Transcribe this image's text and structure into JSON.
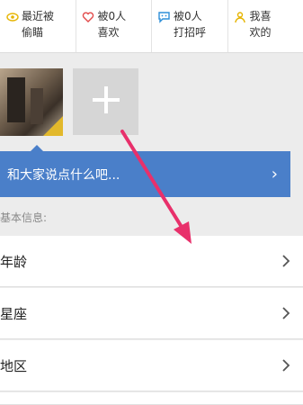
{
  "tabs": [
    {
      "icon": "eye-icon",
      "label": "最近被\n偷瞄"
    },
    {
      "icon": "heart-icon",
      "label": "被0人\n喜欢"
    },
    {
      "icon": "chat-bubble-icon",
      "label": "被0人\n打招呼"
    },
    {
      "icon": "person-icon",
      "label": "我喜\n欢的"
    }
  ],
  "photos": {
    "add_icon": "plus-icon"
  },
  "banner": {
    "text": "和大家说点什么吧...",
    "chevron": "›"
  },
  "section": {
    "label": "基本信息:"
  },
  "rows": [
    {
      "label": "年龄"
    },
    {
      "label": "星座"
    },
    {
      "label": "地区"
    }
  ],
  "colors": {
    "accent_blue": "#4a7fc9",
    "annotation_arrow": "#e8306b",
    "icon_yellow": "#e6b400",
    "icon_red": "#e24a4a",
    "icon_blue": "#2e8fd8"
  }
}
